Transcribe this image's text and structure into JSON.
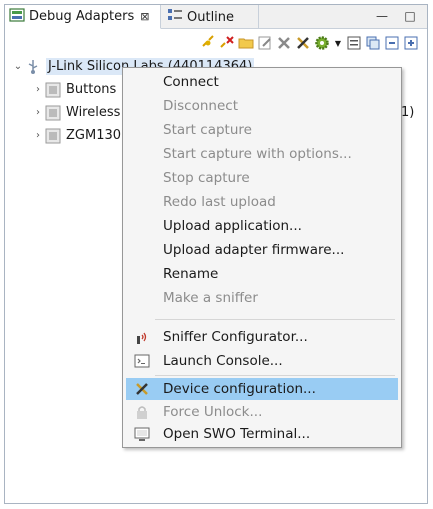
{
  "tabs": {
    "debug_adapters": "Debug Adapters",
    "outline": "Outline"
  },
  "colors": {
    "selection": "#99ccf3",
    "adapter_highlight": "#dbe8f7",
    "disabled_text": "#8c8c8c"
  },
  "toolbar_icons": [
    "connect-icon",
    "disconnect-icon",
    "folder-icon",
    "edit-icon",
    "delete-icon",
    "configure-icon",
    "settings-gear-icon",
    "view-icon",
    "copy-icon",
    "collapse-icon",
    "expand-icon"
  ],
  "tree": {
    "adapter": "J-Link Silicon Labs (440114364)",
    "children": [
      {
        "label": "Buttons"
      },
      {
        "label": "Wireless"
      },
      {
        "label": "ZGM130"
      }
    ],
    "clipped_suffix": "1)"
  },
  "context_menu": {
    "items": [
      {
        "label": "Connect",
        "enabled": true
      },
      {
        "label": "Disconnect",
        "enabled": false
      },
      {
        "label": "Start capture",
        "enabled": false
      },
      {
        "label": "Start capture with options...",
        "enabled": false
      },
      {
        "label": "Stop capture",
        "enabled": false
      },
      {
        "label": "Redo last upload",
        "enabled": false
      },
      {
        "label": "Upload application...",
        "enabled": true
      },
      {
        "label": "Upload adapter firmware...",
        "enabled": true
      },
      {
        "label": "Rename",
        "enabled": true
      },
      {
        "label": "Make a sniffer",
        "enabled": false
      },
      {
        "label": "Sniffer Configurator...",
        "enabled": true,
        "icon": "sniffer-icon"
      },
      {
        "label": "Launch Console...",
        "enabled": true,
        "icon": "console-icon"
      },
      {
        "label": "Device configuration...",
        "enabled": true,
        "icon": "device-config-icon",
        "selected": true
      },
      {
        "label": "Force Unlock...",
        "enabled": false,
        "icon": "lock-icon"
      },
      {
        "label": "Open SWO Terminal...",
        "enabled": true,
        "icon": "terminal-icon"
      }
    ]
  }
}
